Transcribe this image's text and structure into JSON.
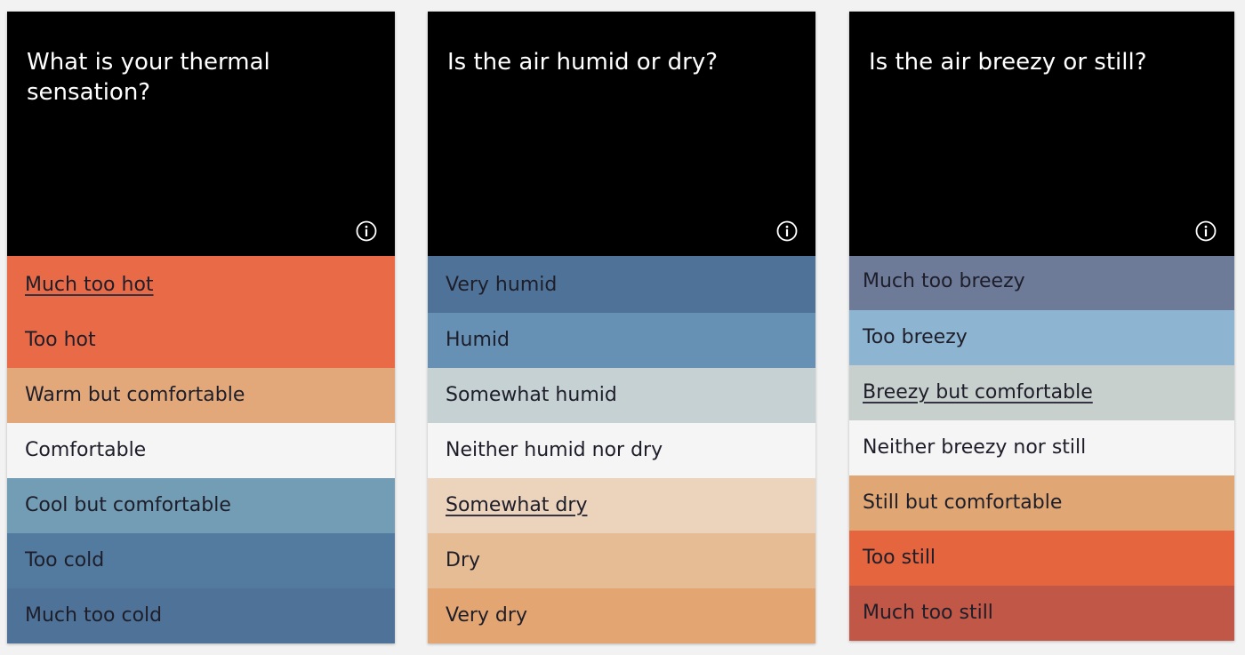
{
  "cards": [
    {
      "question": "What is your thermal sensation?",
      "options": [
        {
          "label": "Much too hot",
          "color": "#e86a47"
        },
        {
          "label": "Too hot",
          "color": "#e86a47"
        },
        {
          "label": "Warm but comfortable",
          "color": "#e2a87a"
        },
        {
          "label": "Comfortable",
          "color": "#f5f5f5"
        },
        {
          "label": "Cool but comfortable",
          "color": "#729db5"
        },
        {
          "label": "Too cold",
          "color": "#537ba0"
        },
        {
          "label": "Much too cold",
          "color": "#4f7398"
        }
      ]
    },
    {
      "question": "Is the air humid or dry?",
      "options": [
        {
          "label": "Very humid",
          "color": "#4f7398"
        },
        {
          "label": "Humid",
          "color": "#6691b5"
        },
        {
          "label": "Somewhat humid",
          "color": "#c5d1d3"
        },
        {
          "label": "Neither humid nor dry",
          "color": "#f5f5f5"
        },
        {
          "label": "Somewhat dry",
          "color": "#ecd3bc"
        },
        {
          "label": "Dry",
          "color": "#e6bc94"
        },
        {
          "label": "Very dry",
          "color": "#e3a572"
        }
      ]
    },
    {
      "question": "Is the air breezy or still?",
      "options": [
        {
          "label": "Much too breezy",
          "color": "#6e7b98"
        },
        {
          "label": "Too breezy",
          "color": "#8db4d0"
        },
        {
          "label": "Breezy but comfortable",
          "color": "#c8d0cd"
        },
        {
          "label": "Neither breezy nor still",
          "color": "#f5f5f5"
        },
        {
          "label": "Still but comfortable",
          "color": "#e0a775"
        },
        {
          "label": "Too still",
          "color": "#e5653f"
        },
        {
          "label": "Much too still",
          "color": "#c15746"
        }
      ]
    }
  ],
  "info_icon": "info-circle-icon"
}
